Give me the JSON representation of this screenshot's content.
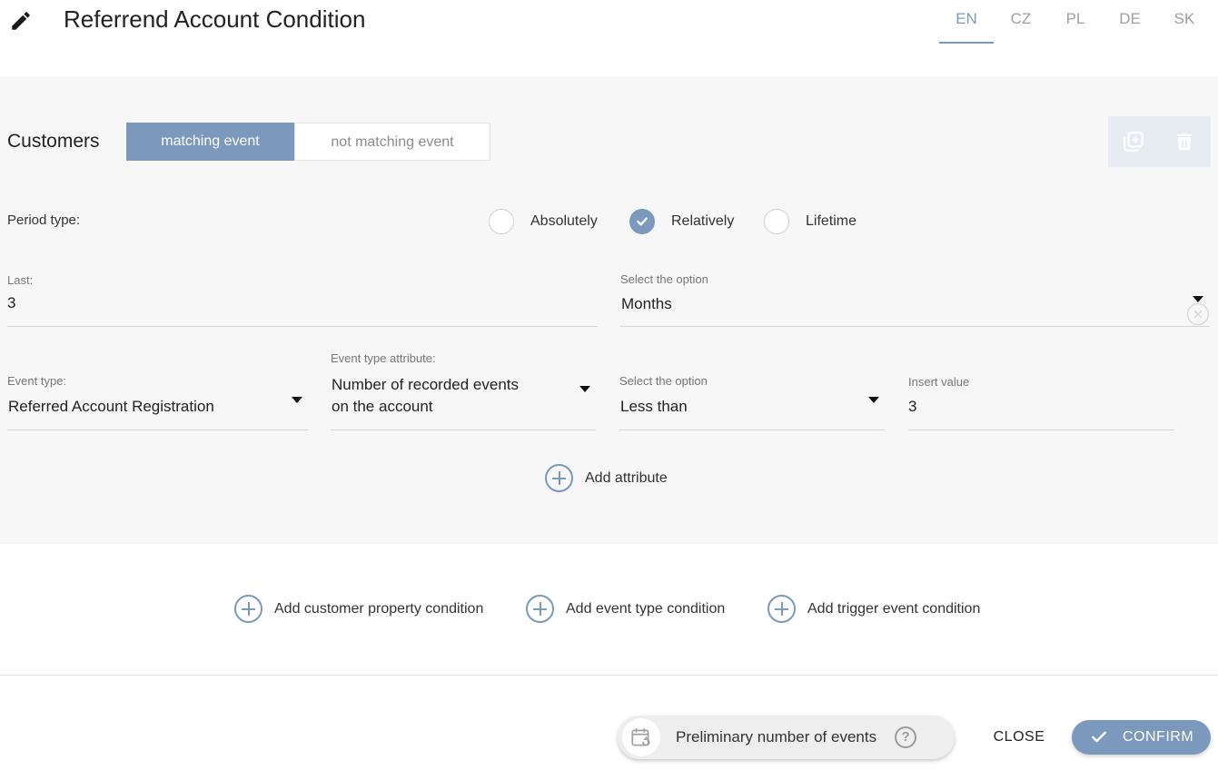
{
  "header": {
    "title": "Referrend Account Condition",
    "languages": [
      {
        "code": "EN",
        "active": true
      },
      {
        "code": "CZ",
        "active": false
      },
      {
        "code": "PL",
        "active": false
      },
      {
        "code": "DE",
        "active": false
      },
      {
        "code": "SK",
        "active": false
      }
    ]
  },
  "condition": {
    "customers_label": "Customers",
    "toggle": {
      "matching": "matching event",
      "not_matching": "not matching event",
      "selected": "matching event"
    },
    "actions": {
      "duplicate_icon": "copy-add-icon",
      "delete_icon": "trash-icon"
    },
    "period": {
      "label": "Period type:",
      "options": [
        "Absolutely",
        "Relatively",
        "Lifetime"
      ],
      "selected": "Relatively"
    },
    "last": {
      "label": "Last:",
      "value": "3"
    },
    "unit": {
      "label": "Select the option",
      "value": "Months"
    },
    "event_type": {
      "label": "Event type:",
      "value": "Referred Account Registration"
    },
    "event_attr": {
      "label": "Event type attribute:",
      "value_line1": "Number of recorded events",
      "value_line2": "on the account"
    },
    "operator": {
      "label": "Select the option",
      "value": "Less than"
    },
    "insert_value": {
      "label": "Insert value",
      "value": "3"
    },
    "add_attribute": "Add attribute"
  },
  "add_conditions": {
    "customer_property": "Add customer property condition",
    "event_type": "Add event type condition",
    "trigger_event": "Add trigger event condition"
  },
  "footer": {
    "preliminary": "Preliminary number of events",
    "help": "?",
    "close": "CLOSE",
    "confirm": "CONFIRM"
  },
  "colors": {
    "accent": "#7a99bd",
    "panel_bg": "#f7f7f7"
  }
}
